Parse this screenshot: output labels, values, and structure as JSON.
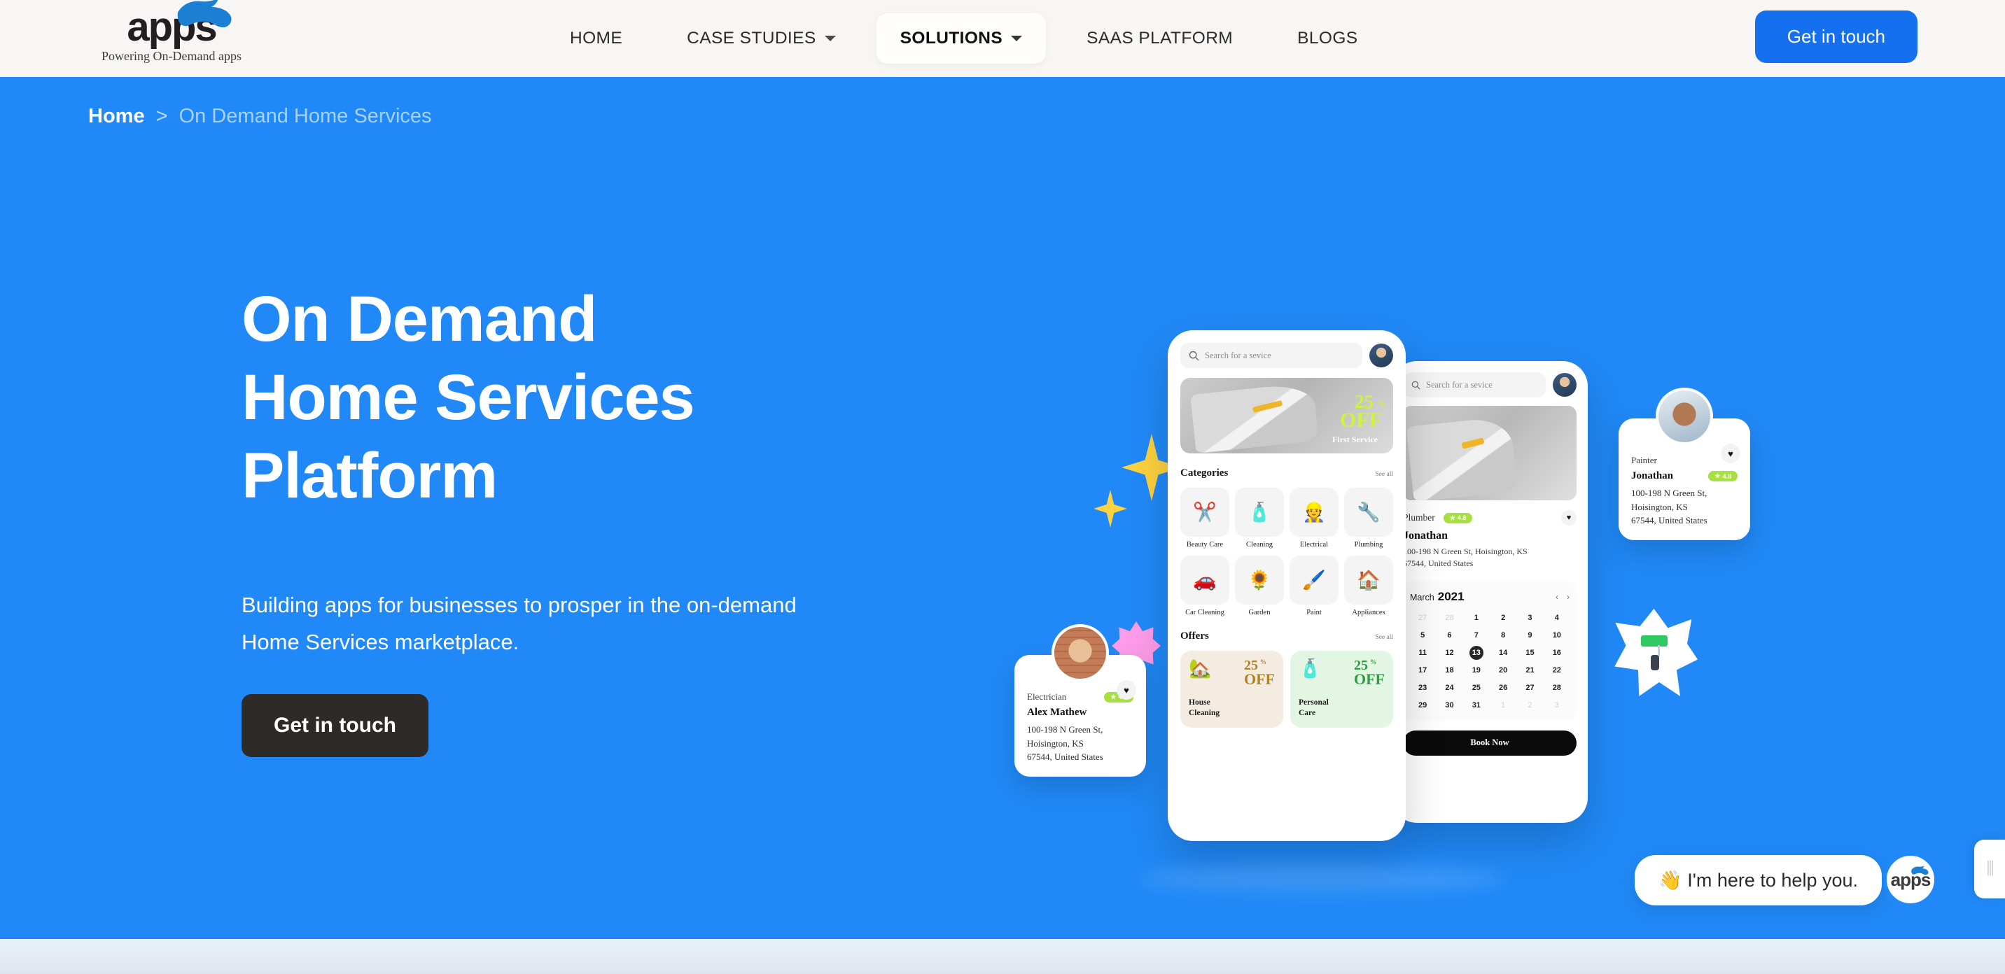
{
  "brand": {
    "logo_word": "apps",
    "logo_tagline": "Powering On-Demand apps",
    "accent_blue": "#2089f7",
    "cta_blue": "#1570f0",
    "dark": "#2e2a27"
  },
  "header": {
    "nav": [
      {
        "label": "HOME",
        "has_caret": false,
        "active": false
      },
      {
        "label": "CASE STUDIES",
        "has_caret": true,
        "active": false
      },
      {
        "label": "SOLUTIONS",
        "has_caret": true,
        "active": true
      },
      {
        "label": "SAAS PLATFORM",
        "has_caret": false,
        "active": false
      },
      {
        "label": "BLOGS",
        "has_caret": false,
        "active": false
      }
    ],
    "cta_label": "Get in touch"
  },
  "breadcrumb": {
    "home": "Home",
    "separator": ">",
    "current": "On Demand Home Services"
  },
  "hero": {
    "title_line1": "On Demand",
    "title_line2": "Home Services",
    "title_line3": "Platform",
    "subtitle_line1": "Building apps for businesses to prosper in the on-demand",
    "subtitle_line2": "Home Services marketplace.",
    "cta_label": "Get in touch"
  },
  "phone_front": {
    "search_placeholder": "Search for a sevice",
    "search_icon": "search-icon",
    "avatar": "user-avatar",
    "promo_banner": {
      "discount": "25",
      "percent": "%",
      "off": "OFF",
      "caption": "First Service"
    },
    "categories_section": {
      "title": "Categories",
      "see_all": "See all",
      "items": [
        {
          "label": "Beauty Care",
          "icon": "✂️"
        },
        {
          "label": "Cleaning",
          "icon": "🧴"
        },
        {
          "label": "Electrical",
          "icon": "👷"
        },
        {
          "label": "Plumbing",
          "icon": "🔧"
        },
        {
          "label": "Car Cleaning",
          "icon": "🚗"
        },
        {
          "label": "Garden",
          "icon": "🌻"
        },
        {
          "label": "Paint",
          "icon": "🖌️"
        },
        {
          "label": "Appliances",
          "icon": "🏠"
        }
      ]
    },
    "offers_section": {
      "title": "Offers",
      "see_all": "See all",
      "items": [
        {
          "name_line1": "House",
          "name_line2": "Cleaning",
          "discount": "25",
          "percent": "%",
          "off": "OFF",
          "icon": "🏡"
        },
        {
          "name_line1": "Personal",
          "name_line2": "Care",
          "discount": "25",
          "percent": "%",
          "off": "OFF",
          "icon": "🧴"
        }
      ]
    }
  },
  "phone_back": {
    "search_placeholder": "Search for a sevice",
    "provider": {
      "role": "Plumber",
      "rating": "4.8",
      "name": "Jonathan",
      "address_line1": "100-198 N Green St, Hoisington, KS",
      "address_line2": "67544, United States"
    },
    "calendar": {
      "month": "March",
      "year": "2021",
      "prev": "‹",
      "next": "›",
      "selected_day": "13",
      "weeks": [
        [
          "27",
          "28",
          "1",
          "2",
          "3",
          "4"
        ],
        [
          "5",
          "6",
          "7",
          "8",
          "9",
          "10"
        ],
        [
          "11",
          "12",
          "13",
          "14",
          "15",
          "16"
        ],
        [
          "17",
          "18",
          "19",
          "20",
          "21",
          "22"
        ],
        [
          "23",
          "24",
          "25",
          "26",
          "27",
          "28"
        ],
        [
          "29",
          "30",
          "31",
          "1",
          "2",
          "3"
        ]
      ],
      "muted_cells": [
        "0-0",
        "0-1",
        "5-3",
        "5-4",
        "5-5"
      ]
    },
    "book_label": "Book Now"
  },
  "card_left": {
    "role": "Electrician",
    "rating": "4.8",
    "name": "Alex Mathew",
    "address_line1": "100-198 N Green St,",
    "address_line2": "Hoisington, KS",
    "address_line3": "67544, United States"
  },
  "card_right": {
    "role": "Painter",
    "rating": "4.8",
    "name": "Jonathan",
    "address_line1": "100-198 N Green St,",
    "address_line2": "Hoisington, KS",
    "address_line3": "67544, United States"
  },
  "chat": {
    "message": "👋 I'm here to help you.",
    "orb_label": "apps",
    "side_glyph": "⫼"
  }
}
